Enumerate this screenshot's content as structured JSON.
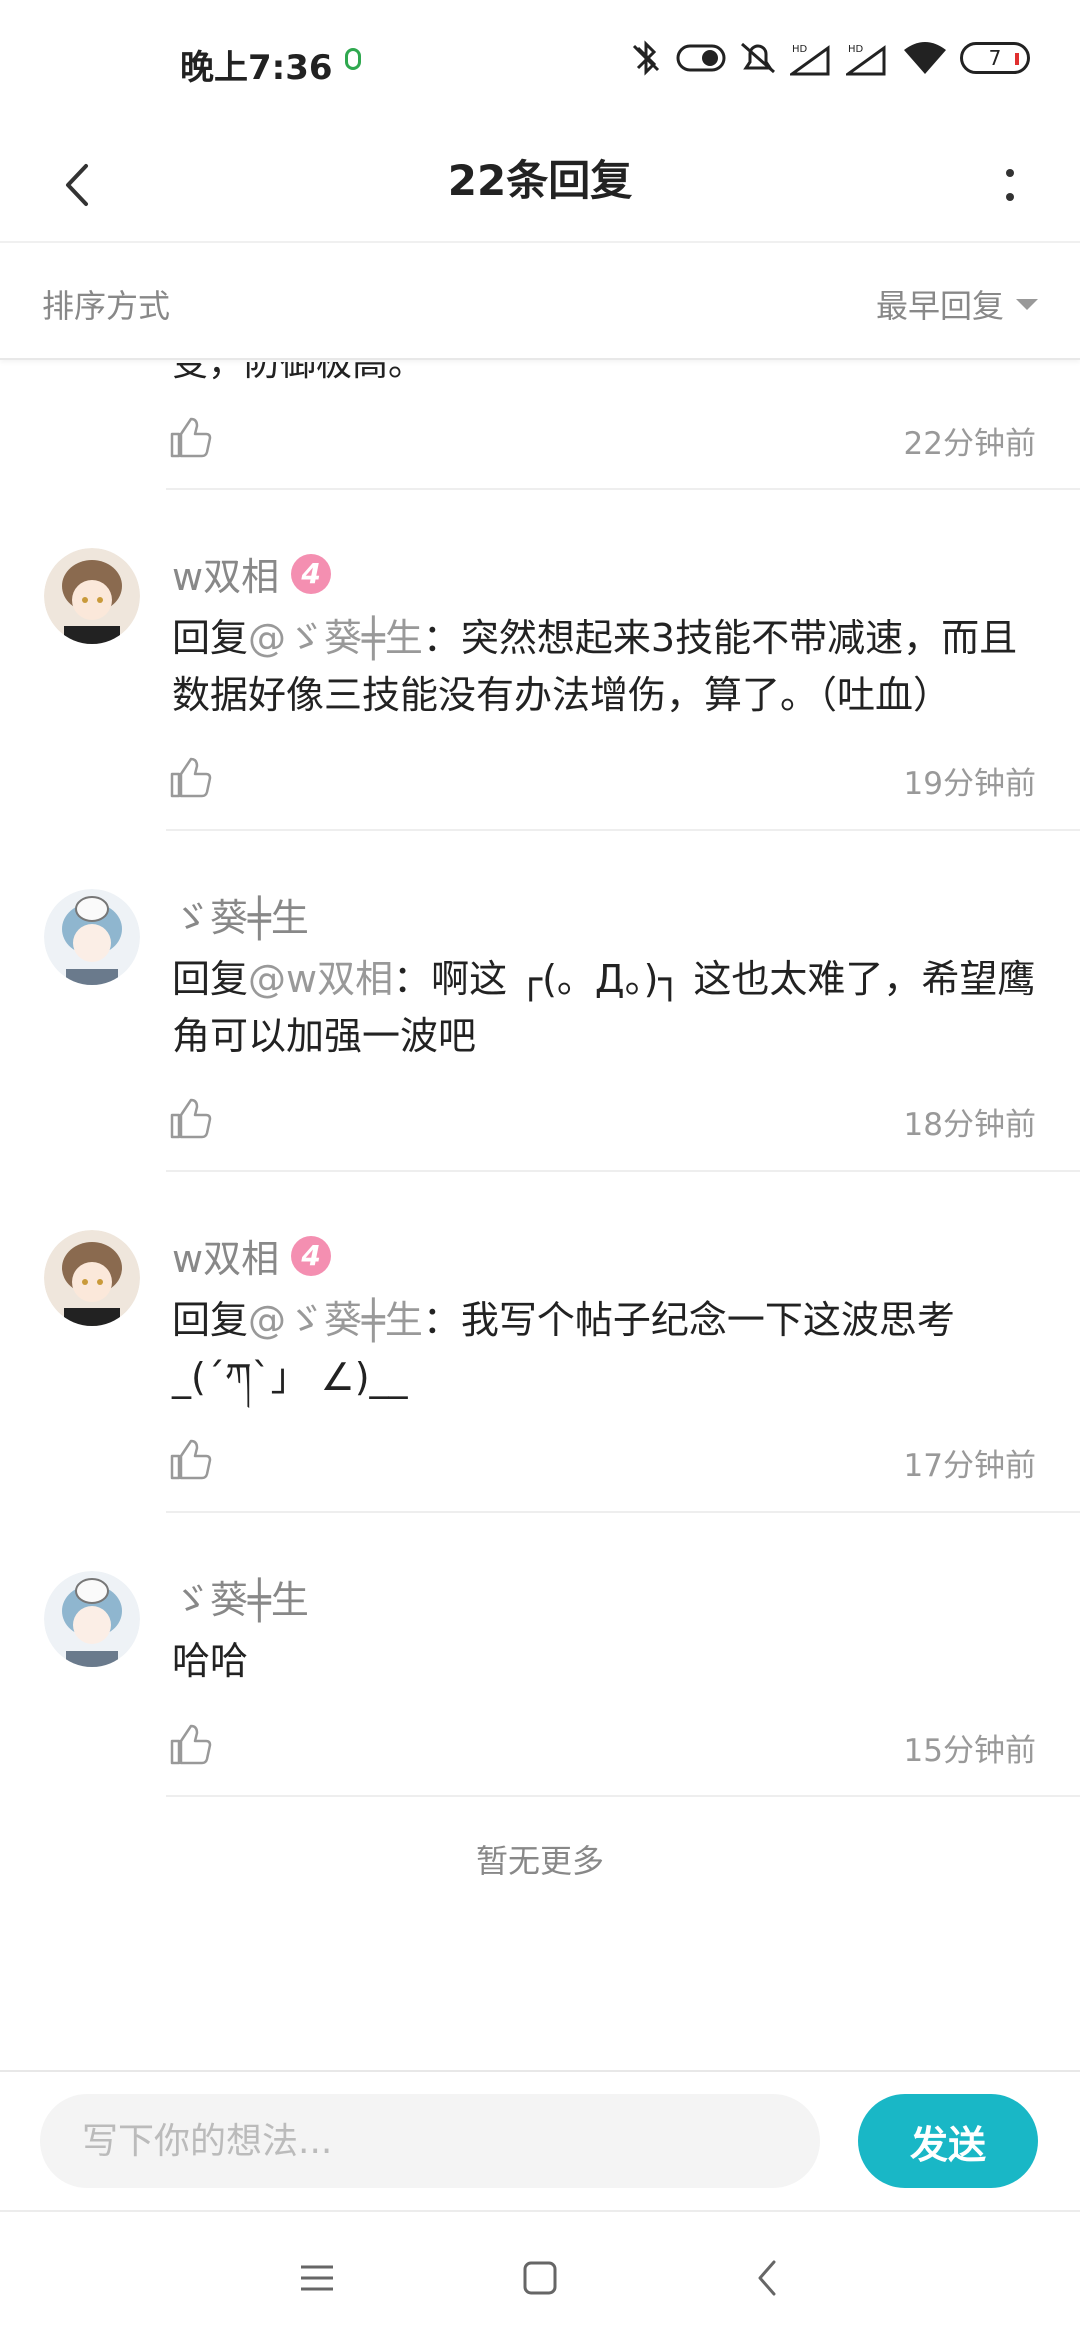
{
  "status_bar": {
    "time": "晚上7:36",
    "battery": "7",
    "icons": [
      "bluetooth-off-icon",
      "toggle-icon",
      "silent-bell-icon",
      "signal-hd-icon",
      "signal-hd-icon",
      "wifi-icon",
      "battery-icon"
    ]
  },
  "header": {
    "title": "22条回复",
    "back_icon": "chevron-left-icon",
    "more_icon": "more-vertical-icon"
  },
  "sort": {
    "label": "排序方式",
    "selected": "最早回复"
  },
  "cut_off": {
    "text": "变，防御极高。",
    "time": "22分钟前"
  },
  "replies": [
    {
      "name": "w双相",
      "level": "4",
      "prefix": "回复",
      "mention": "@ゞ葵╪生",
      "body": "：突然想起来3技能不带减速，而且数据好像三技能没有办法增伤，算了。（吐血）",
      "time": "19分钟前"
    },
    {
      "name": "ゞ葵╪生",
      "level": "",
      "prefix": "回复",
      "mention": "@w双相",
      "body": "：啊这 ┌(。Д。)┐ 这也太难了，希望鹰角可以加强一波吧",
      "time": "18分钟前"
    },
    {
      "name": "w双相",
      "level": "4",
      "prefix": "回复",
      "mention": "@ゞ葵╪生",
      "body": "：我写个帖子纪念一下这波思考 _(´ཀ`」 ∠)__",
      "time": "17分钟前"
    },
    {
      "name": "ゞ葵╪生",
      "level": "",
      "prefix": "",
      "mention": "",
      "body": "哈哈",
      "time": "15分钟前"
    }
  ],
  "no_more": "暂无更多",
  "input": {
    "placeholder": "写下你的想法...",
    "send_label": "发送"
  },
  "colors": {
    "accent": "#19b7c6",
    "level_badge": "#f48fb1",
    "muted_text": "#888888"
  }
}
